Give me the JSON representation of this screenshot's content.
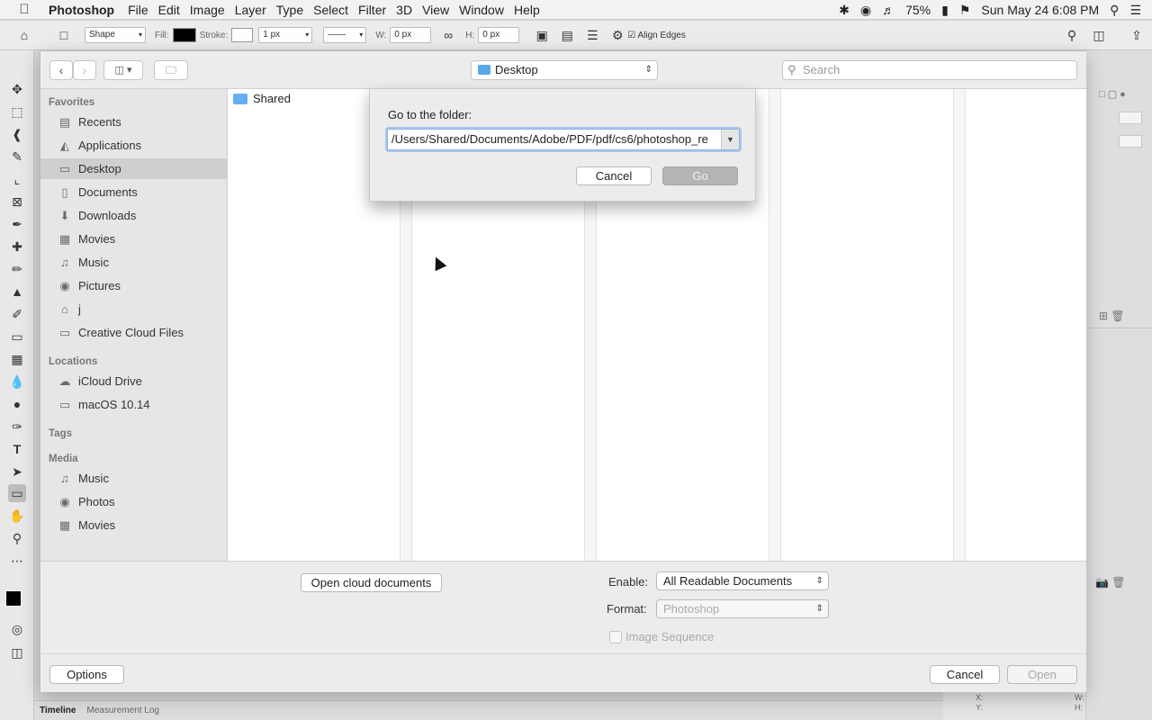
{
  "menubar": {
    "app_name": "Photoshop",
    "items": [
      "File",
      "Edit",
      "Image",
      "Layer",
      "Type",
      "Select",
      "Filter",
      "3D",
      "View",
      "Window",
      "Help"
    ],
    "battery": "75%",
    "datetime": "Sun May 24  6:08 PM"
  },
  "options_bar": {
    "shape_mode": "Shape",
    "fill_label": "Fill:",
    "stroke_label": "Stroke:",
    "stroke_width": "1 px",
    "w_label": "W:",
    "w_value": "0 px",
    "h_label": "H:",
    "h_value": "0 px",
    "align_edges": "Align Edges",
    "fill_color": "#000000"
  },
  "dialog": {
    "location": "Desktop",
    "search_placeholder": "Search",
    "sidebar": {
      "favorites_label": "Favorites",
      "favorites": [
        {
          "label": "Recents",
          "icon": "recents-icon",
          "glyph": "▤"
        },
        {
          "label": "Applications",
          "icon": "applications-icon",
          "glyph": "◭"
        },
        {
          "label": "Desktop",
          "icon": "desktop-icon",
          "glyph": "▭"
        },
        {
          "label": "Documents",
          "icon": "documents-icon",
          "glyph": "▯"
        },
        {
          "label": "Downloads",
          "icon": "downloads-icon",
          "glyph": "⬇"
        },
        {
          "label": "Movies",
          "icon": "movies-icon",
          "glyph": "▦"
        },
        {
          "label": "Music",
          "icon": "music-icon",
          "glyph": "♫"
        },
        {
          "label": "Pictures",
          "icon": "pictures-icon",
          "glyph": "◉"
        },
        {
          "label": "j",
          "icon": "home-icon",
          "glyph": "⌂"
        },
        {
          "label": "Creative Cloud Files",
          "icon": "folder-icon",
          "glyph": "▭"
        }
      ],
      "locations_label": "Locations",
      "locations": [
        {
          "label": "iCloud Drive",
          "icon": "icloud-icon",
          "glyph": "☁"
        },
        {
          "label": "macOS 10.14",
          "icon": "disk-icon",
          "glyph": "▭"
        }
      ],
      "tags_label": "Tags",
      "media_label": "Media",
      "media": [
        {
          "label": "Music",
          "icon": "music-icon",
          "glyph": "♫"
        },
        {
          "label": "Photos",
          "icon": "photos-icon",
          "glyph": "◉"
        },
        {
          "label": "Movies",
          "icon": "movies-icon",
          "glyph": "▦"
        }
      ]
    },
    "browser": {
      "items": [
        "Shared"
      ]
    },
    "bottom": {
      "open_cloud_label": "Open cloud documents",
      "enable_label": "Enable:",
      "enable_value": "All Readable Documents",
      "format_label": "Format:",
      "format_value": "Photoshop",
      "image_sequence_label": "Image Sequence",
      "options_label": "Options",
      "cancel_label": "Cancel",
      "open_label": "Open"
    },
    "goto": {
      "label": "Go to the folder:",
      "path": "/Users/Shared/Documents/Adobe/PDF/pdf/cs6/photoshop_re",
      "cancel_label": "Cancel",
      "go_label": "Go"
    }
  },
  "bottom_tabs": [
    "Timeline",
    "Measurement Log"
  ],
  "info_panel": {
    "x_label": "X:",
    "y_label": "Y:",
    "w_label": "W:",
    "h_label": "H:"
  }
}
